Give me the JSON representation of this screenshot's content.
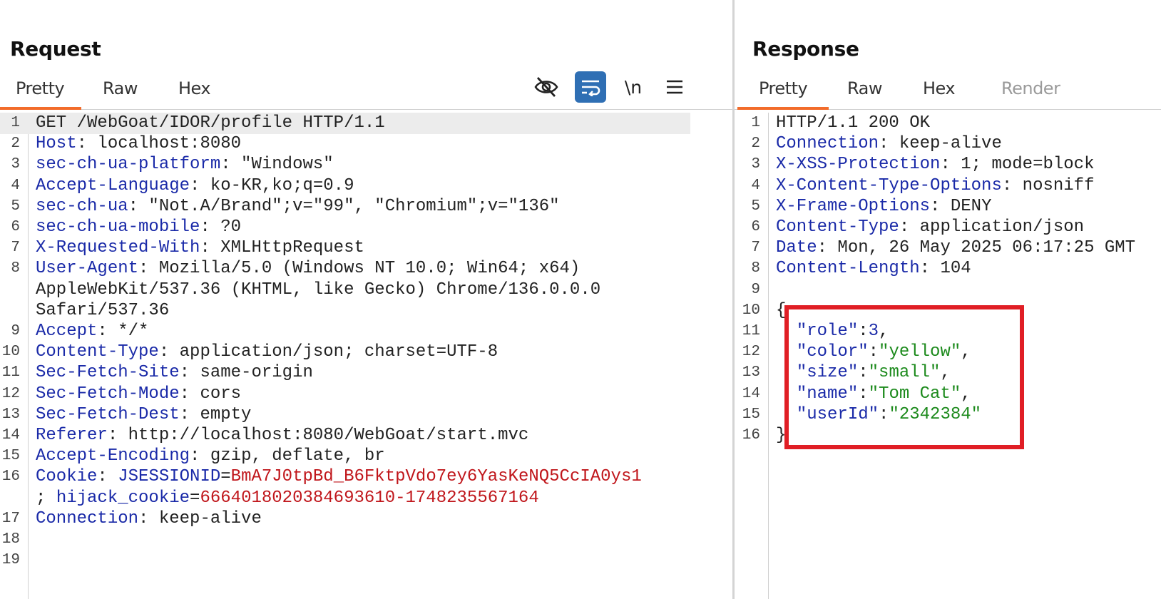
{
  "request": {
    "title": "Request",
    "tabs": [
      "Pretty",
      "Raw",
      "Hex"
    ],
    "active_tab": "Pretty",
    "toolbar": {
      "newline_label": "\\n",
      "icons": [
        "eye-off-icon",
        "wrap-icon",
        "newline-icon",
        "menu-icon"
      ]
    },
    "lines": [
      {
        "n": "1",
        "text": "GET /WebGoat/IDOR/profile HTTP/1.1"
      },
      {
        "n": "2",
        "key": "Host",
        "val": " localhost:8080"
      },
      {
        "n": "3",
        "key": "sec-ch-ua-platform",
        "val": " \"Windows\""
      },
      {
        "n": "4",
        "key": "Accept-Language",
        "val": " ko-KR,ko;q=0.9"
      },
      {
        "n": "5",
        "key": "sec-ch-ua",
        "val": " \"Not.A/Brand\";v=\"99\", \"Chromium\";v=\"136\""
      },
      {
        "n": "6",
        "key": "sec-ch-ua-mobile",
        "val": " ?0"
      },
      {
        "n": "7",
        "key": "X-Requested-With",
        "val": " XMLHttpRequest"
      },
      {
        "n": "8",
        "key": "User-Agent",
        "val": " Mozilla/5.0 (Windows NT 10.0; Win64; x64)"
      },
      {
        "n": "",
        "text": "AppleWebKit/537.36 (KHTML, like Gecko) Chrome/136.0.0.0"
      },
      {
        "n": "",
        "text": "Safari/537.36"
      },
      {
        "n": "9",
        "key": "Accept",
        "val": " */*"
      },
      {
        "n": "10",
        "key": "Content-Type",
        "val": " application/json; charset=UTF-8"
      },
      {
        "n": "11",
        "key": "Sec-Fetch-Site",
        "val": " same-origin"
      },
      {
        "n": "12",
        "key": "Sec-Fetch-Mode",
        "val": " cors"
      },
      {
        "n": "13",
        "key": "Sec-Fetch-Dest",
        "val": " empty"
      },
      {
        "n": "14",
        "key": "Referer",
        "val": " http://localhost:8080/WebGoat/start.mvc"
      },
      {
        "n": "15",
        "key": "Accept-Encoding",
        "val": " gzip, deflate, br"
      },
      {
        "n": "16",
        "key": "Cookie",
        "cookie1_name": " JSESSIONID",
        "cookie1_val": "BmA7J0tpBd_B6FktpVdo7ey6YasKeNQ5CcIA0ys1"
      },
      {
        "n": "",
        "cookie2_prefix": "; ",
        "cookie2_name": "hijack_cookie",
        "cookie2_val": "6664018020384693610-1748235567164"
      },
      {
        "n": "17",
        "key": "Connection",
        "val": " keep-alive"
      },
      {
        "n": "18",
        "text": ""
      },
      {
        "n": "19",
        "text": ""
      }
    ]
  },
  "response": {
    "title": "Response",
    "tabs": [
      "Pretty",
      "Raw",
      "Hex",
      "Render"
    ],
    "active_tab": "Pretty",
    "lines": [
      {
        "n": "1",
        "text": "HTTP/1.1 200 OK"
      },
      {
        "n": "2",
        "key": "Connection",
        "val": " keep-alive"
      },
      {
        "n": "3",
        "key": "X-XSS-Protection",
        "val": " 1; mode=block"
      },
      {
        "n": "4",
        "key": "X-Content-Type-Options",
        "val": " nosniff"
      },
      {
        "n": "5",
        "key": "X-Frame-Options",
        "val": " DENY"
      },
      {
        "n": "6",
        "key": "Content-Type",
        "val": " application/json"
      },
      {
        "n": "7",
        "key": "Date",
        "val": " Mon, 26 May 2025 06:17:25 GMT"
      },
      {
        "n": "8",
        "key": "Content-Length",
        "val": " 104"
      },
      {
        "n": "9",
        "text": ""
      },
      {
        "n": "10",
        "text": "{"
      },
      {
        "n": "11",
        "jkey": "\"role\"",
        "jnum": "3",
        "trail": ","
      },
      {
        "n": "12",
        "jkey": "\"color\"",
        "jstr": "\"yellow\"",
        "trail": ","
      },
      {
        "n": "13",
        "jkey": "\"size\"",
        "jstr": "\"small\"",
        "trail": ","
      },
      {
        "n": "14",
        "jkey": "\"name\"",
        "jstr": "\"Tom Cat\"",
        "trail": ","
      },
      {
        "n": "15",
        "jkey": "\"userId\"",
        "jstr": "\"2342384\"",
        "trail": ""
      },
      {
        "n": "16",
        "text": "}"
      }
    ],
    "highlight_color": "#e01e25"
  },
  "colors": {
    "accent_tab": "#f26c2b",
    "header_key": "#1a2aa8",
    "cookie_value": "#c0161b",
    "json_string": "#1c8a1c",
    "wrap_button": "#2f6fb4"
  }
}
